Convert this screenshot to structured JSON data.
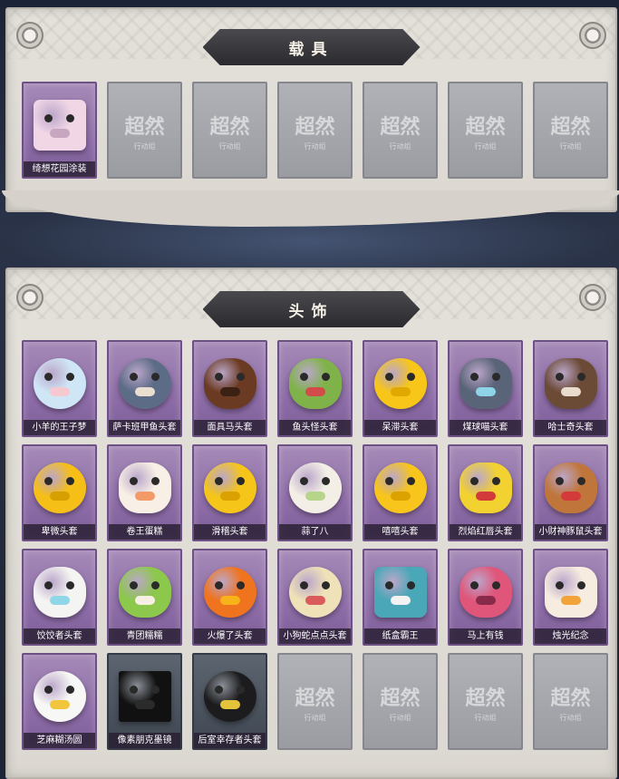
{
  "vehicle_section": {
    "title": "载具",
    "items": [
      {
        "label": "绮想花园涂装",
        "state": "owned",
        "icon": "food-truck-icon"
      },
      {
        "state": "empty",
        "watermark": "超然",
        "watermark_sub": "行动组"
      },
      {
        "state": "empty",
        "watermark": "超然",
        "watermark_sub": "行动组"
      },
      {
        "state": "empty",
        "watermark": "超然",
        "watermark_sub": "行动组"
      },
      {
        "state": "empty",
        "watermark": "超然",
        "watermark_sub": "行动组"
      },
      {
        "state": "empty",
        "watermark": "超然",
        "watermark_sub": "行动组"
      },
      {
        "state": "empty",
        "watermark": "超然",
        "watermark_sub": "行动组"
      }
    ]
  },
  "head_section": {
    "title": "头饰",
    "items": [
      {
        "label": "小羊的王子梦",
        "icon": "sheep-crown-icon"
      },
      {
        "label": "萨卡班甲鱼头套",
        "icon": "fish-head-icon"
      },
      {
        "label": "面具马头套",
        "icon": "horse-head-icon"
      },
      {
        "label": "鱼头怪头套",
        "icon": "green-fish-icon"
      },
      {
        "label": "呆滞头套",
        "icon": "dazed-emoji-icon"
      },
      {
        "label": "煤球喵头套",
        "icon": "cat-head-icon"
      },
      {
        "label": "哈士奇头套",
        "icon": "husky-head-icon"
      },
      {
        "label": "卑微头套",
        "icon": "humble-emoji-icon"
      },
      {
        "label": "卷王蛋糕",
        "icon": "roll-cake-icon"
      },
      {
        "label": "滑稽头套",
        "icon": "funny-emoji-icon"
      },
      {
        "label": "蒜了八",
        "icon": "garlic-icon"
      },
      {
        "label": "嘻嘻头套",
        "icon": "grin-emoji-icon"
      },
      {
        "label": "烈焰红唇头套",
        "icon": "yellow-mascot-icon"
      },
      {
        "label": "小财神豚鼠头套",
        "icon": "capybara-icon"
      },
      {
        "label": "饺饺者头套",
        "icon": "dumpling-icon"
      },
      {
        "label": "青团糯糯",
        "icon": "green-rice-ball-icon"
      },
      {
        "label": "火爆了头套",
        "icon": "fire-spirit-icon"
      },
      {
        "label": "小狗蛇点点头套",
        "icon": "puppy-snake-icon"
      },
      {
        "label": "纸盒霸王",
        "icon": "box-dino-icon"
      },
      {
        "label": "马上有钱",
        "icon": "red-horse-icon"
      },
      {
        "label": "烛光纪念",
        "icon": "candle-icon"
      },
      {
        "label": "芝麻糊汤圆",
        "icon": "rice-ball-icon"
      },
      {
        "label": "像素朋克墨镜",
        "icon": "pixel-sunglasses-icon"
      },
      {
        "label": "后室幸存者头套",
        "icon": "gas-mask-helmet-icon"
      },
      {
        "state": "empty",
        "watermark": "超然",
        "watermark_sub": "行动组"
      },
      {
        "state": "empty",
        "watermark": "超然",
        "watermark_sub": "行动组"
      },
      {
        "state": "empty",
        "watermark": "超然",
        "watermark_sub": "行动组"
      },
      {
        "state": "empty",
        "watermark": "超然",
        "watermark_sub": "行动组"
      }
    ]
  },
  "colors": {
    "owned_slot": "#9a7db2",
    "empty_slot": "#a3a5aa",
    "banner": "#333337",
    "panel": "#dfdcd6"
  }
}
